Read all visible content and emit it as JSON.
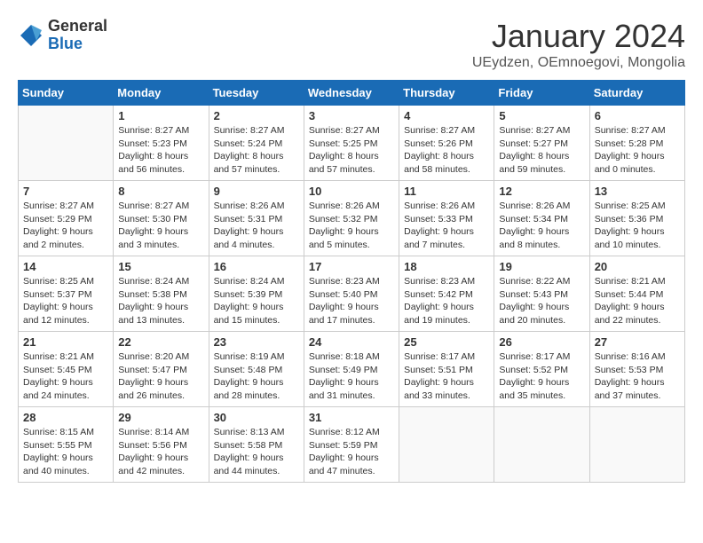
{
  "header": {
    "logo": {
      "general": "General",
      "blue": "Blue"
    },
    "title": "January 2024",
    "subtitle": "UEydzen, OEmnoegovi, Mongolia"
  },
  "calendar": {
    "weekdays": [
      "Sunday",
      "Monday",
      "Tuesday",
      "Wednesday",
      "Thursday",
      "Friday",
      "Saturday"
    ],
    "weeks": [
      [
        {
          "day": null,
          "info": null
        },
        {
          "day": "1",
          "sunrise": "Sunrise: 8:27 AM",
          "sunset": "Sunset: 5:23 PM",
          "daylight": "Daylight: 8 hours and 56 minutes."
        },
        {
          "day": "2",
          "sunrise": "Sunrise: 8:27 AM",
          "sunset": "Sunset: 5:24 PM",
          "daylight": "Daylight: 8 hours and 57 minutes."
        },
        {
          "day": "3",
          "sunrise": "Sunrise: 8:27 AM",
          "sunset": "Sunset: 5:25 PM",
          "daylight": "Daylight: 8 hours and 57 minutes."
        },
        {
          "day": "4",
          "sunrise": "Sunrise: 8:27 AM",
          "sunset": "Sunset: 5:26 PM",
          "daylight": "Daylight: 8 hours and 58 minutes."
        },
        {
          "day": "5",
          "sunrise": "Sunrise: 8:27 AM",
          "sunset": "Sunset: 5:27 PM",
          "daylight": "Daylight: 8 hours and 59 minutes."
        },
        {
          "day": "6",
          "sunrise": "Sunrise: 8:27 AM",
          "sunset": "Sunset: 5:28 PM",
          "daylight": "Daylight: 9 hours and 0 minutes."
        }
      ],
      [
        {
          "day": "7",
          "sunrise": "Sunrise: 8:27 AM",
          "sunset": "Sunset: 5:29 PM",
          "daylight": "Daylight: 9 hours and 2 minutes."
        },
        {
          "day": "8",
          "sunrise": "Sunrise: 8:27 AM",
          "sunset": "Sunset: 5:30 PM",
          "daylight": "Daylight: 9 hours and 3 minutes."
        },
        {
          "day": "9",
          "sunrise": "Sunrise: 8:26 AM",
          "sunset": "Sunset: 5:31 PM",
          "daylight": "Daylight: 9 hours and 4 minutes."
        },
        {
          "day": "10",
          "sunrise": "Sunrise: 8:26 AM",
          "sunset": "Sunset: 5:32 PM",
          "daylight": "Daylight: 9 hours and 5 minutes."
        },
        {
          "day": "11",
          "sunrise": "Sunrise: 8:26 AM",
          "sunset": "Sunset: 5:33 PM",
          "daylight": "Daylight: 9 hours and 7 minutes."
        },
        {
          "day": "12",
          "sunrise": "Sunrise: 8:26 AM",
          "sunset": "Sunset: 5:34 PM",
          "daylight": "Daylight: 9 hours and 8 minutes."
        },
        {
          "day": "13",
          "sunrise": "Sunrise: 8:25 AM",
          "sunset": "Sunset: 5:36 PM",
          "daylight": "Daylight: 9 hours and 10 minutes."
        }
      ],
      [
        {
          "day": "14",
          "sunrise": "Sunrise: 8:25 AM",
          "sunset": "Sunset: 5:37 PM",
          "daylight": "Daylight: 9 hours and 12 minutes."
        },
        {
          "day": "15",
          "sunrise": "Sunrise: 8:24 AM",
          "sunset": "Sunset: 5:38 PM",
          "daylight": "Daylight: 9 hours and 13 minutes."
        },
        {
          "day": "16",
          "sunrise": "Sunrise: 8:24 AM",
          "sunset": "Sunset: 5:39 PM",
          "daylight": "Daylight: 9 hours and 15 minutes."
        },
        {
          "day": "17",
          "sunrise": "Sunrise: 8:23 AM",
          "sunset": "Sunset: 5:40 PM",
          "daylight": "Daylight: 9 hours and 17 minutes."
        },
        {
          "day": "18",
          "sunrise": "Sunrise: 8:23 AM",
          "sunset": "Sunset: 5:42 PM",
          "daylight": "Daylight: 9 hours and 19 minutes."
        },
        {
          "day": "19",
          "sunrise": "Sunrise: 8:22 AM",
          "sunset": "Sunset: 5:43 PM",
          "daylight": "Daylight: 9 hours and 20 minutes."
        },
        {
          "day": "20",
          "sunrise": "Sunrise: 8:21 AM",
          "sunset": "Sunset: 5:44 PM",
          "daylight": "Daylight: 9 hours and 22 minutes."
        }
      ],
      [
        {
          "day": "21",
          "sunrise": "Sunrise: 8:21 AM",
          "sunset": "Sunset: 5:45 PM",
          "daylight": "Daylight: 9 hours and 24 minutes."
        },
        {
          "day": "22",
          "sunrise": "Sunrise: 8:20 AM",
          "sunset": "Sunset: 5:47 PM",
          "daylight": "Daylight: 9 hours and 26 minutes."
        },
        {
          "day": "23",
          "sunrise": "Sunrise: 8:19 AM",
          "sunset": "Sunset: 5:48 PM",
          "daylight": "Daylight: 9 hours and 28 minutes."
        },
        {
          "day": "24",
          "sunrise": "Sunrise: 8:18 AM",
          "sunset": "Sunset: 5:49 PM",
          "daylight": "Daylight: 9 hours and 31 minutes."
        },
        {
          "day": "25",
          "sunrise": "Sunrise: 8:17 AM",
          "sunset": "Sunset: 5:51 PM",
          "daylight": "Daylight: 9 hours and 33 minutes."
        },
        {
          "day": "26",
          "sunrise": "Sunrise: 8:17 AM",
          "sunset": "Sunset: 5:52 PM",
          "daylight": "Daylight: 9 hours and 35 minutes."
        },
        {
          "day": "27",
          "sunrise": "Sunrise: 8:16 AM",
          "sunset": "Sunset: 5:53 PM",
          "daylight": "Daylight: 9 hours and 37 minutes."
        }
      ],
      [
        {
          "day": "28",
          "sunrise": "Sunrise: 8:15 AM",
          "sunset": "Sunset: 5:55 PM",
          "daylight": "Daylight: 9 hours and 40 minutes."
        },
        {
          "day": "29",
          "sunrise": "Sunrise: 8:14 AM",
          "sunset": "Sunset: 5:56 PM",
          "daylight": "Daylight: 9 hours and 42 minutes."
        },
        {
          "day": "30",
          "sunrise": "Sunrise: 8:13 AM",
          "sunset": "Sunset: 5:58 PM",
          "daylight": "Daylight: 9 hours and 44 minutes."
        },
        {
          "day": "31",
          "sunrise": "Sunrise: 8:12 AM",
          "sunset": "Sunset: 5:59 PM",
          "daylight": "Daylight: 9 hours and 47 minutes."
        },
        {
          "day": null,
          "info": null
        },
        {
          "day": null,
          "info": null
        },
        {
          "day": null,
          "info": null
        }
      ]
    ]
  }
}
